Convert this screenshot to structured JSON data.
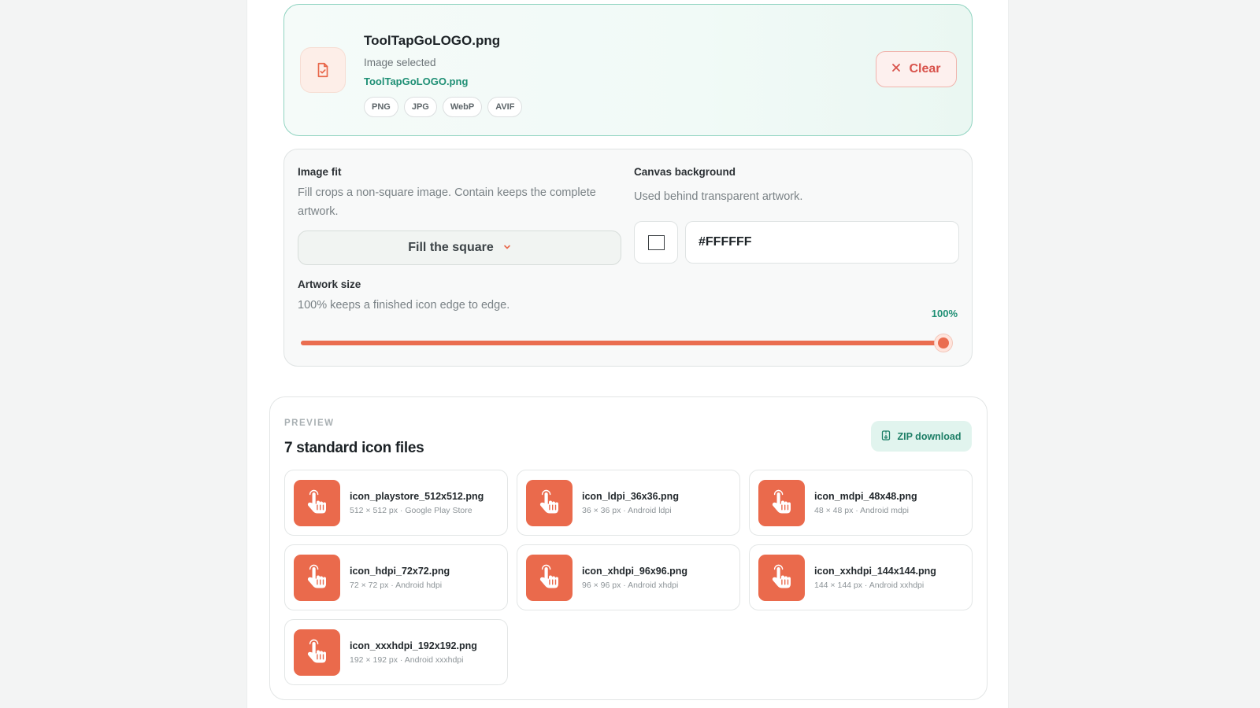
{
  "file": {
    "name": "ToolTapGoLOGO.png",
    "status": "Image selected",
    "link": "ToolTapGoLOGO.png",
    "formats": [
      "PNG",
      "JPG",
      "WebP",
      "AVIF"
    ],
    "clear_label": "Clear"
  },
  "settings": {
    "fit_label": "Image fit",
    "fit_desc": "Fill crops a non-square image. Contain keeps the complete artwork.",
    "fit_value": "Fill the square",
    "bg_label": "Canvas background",
    "bg_desc": "Used behind transparent artwork.",
    "bg_value": "#FFFFFF",
    "size_label": "Artwork size",
    "size_desc": "100% keeps a finished icon edge to edge.",
    "size_value_text": "100%",
    "size_value": 100
  },
  "preview": {
    "eyebrow": "PREVIEW",
    "title": "7 standard icon files",
    "zip_label": "ZIP download",
    "files": [
      {
        "name": "icon_playstore_512x512.png",
        "sub": "512 × 512 px · Google Play Store"
      },
      {
        "name": "icon_ldpi_36x36.png",
        "sub": "36 × 36 px · Android ldpi"
      },
      {
        "name": "icon_mdpi_48x48.png",
        "sub": "48 × 48 px · Android mdpi"
      },
      {
        "name": "icon_hdpi_72x72.png",
        "sub": "72 × 72 px · Android hdpi"
      },
      {
        "name": "icon_xhdpi_96x96.png",
        "sub": "96 × 96 px · Android xhdpi"
      },
      {
        "name": "icon_xxhdpi_144x144.png",
        "sub": "144 × 144 px · Android xxhdpi"
      },
      {
        "name": "icon_xxxhdpi_192x192.png",
        "sub": "192 × 192 px · Android xxxhdpi"
      }
    ]
  },
  "colors": {
    "accent": "#ea6a4c",
    "teal": "#1e8f74",
    "danger": "#d8524b"
  },
  "icons": {
    "file_thumb": "file-check-icon",
    "clear": "close-icon",
    "select": "chevron-down-icon",
    "zip": "archive-icon",
    "app": "pointing-hand-icon"
  }
}
